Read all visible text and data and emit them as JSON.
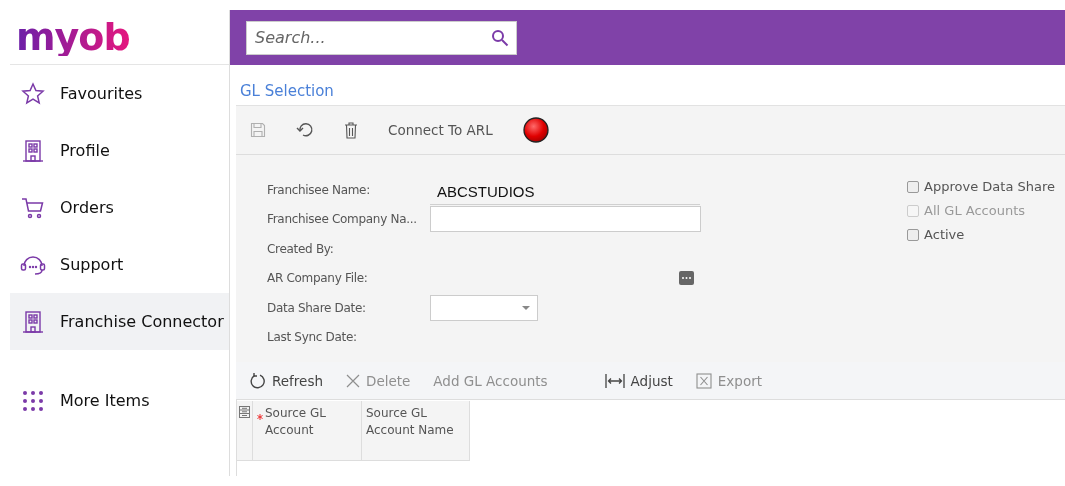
{
  "logo": "myob",
  "sidebar": {
    "items": [
      {
        "label": "Favourites",
        "kind": "star",
        "selected": false
      },
      {
        "label": "Profile",
        "kind": "building",
        "selected": false
      },
      {
        "label": "Orders",
        "kind": "cart",
        "selected": false
      },
      {
        "label": "Support",
        "kind": "headset",
        "selected": false
      },
      {
        "label": "Franchise Connector",
        "kind": "building",
        "selected": true
      },
      {
        "label": "More Items",
        "kind": "dots",
        "selected": false
      }
    ]
  },
  "search": {
    "placeholder": "Search..."
  },
  "page_title": "GL Selection",
  "toolbar": [
    {
      "kind": "save",
      "disabled": true
    },
    {
      "kind": "undo",
      "disabled": false
    },
    {
      "kind": "delete",
      "disabled": false
    },
    {
      "kind": "text",
      "label": "Connect To ARL",
      "disabled": false
    },
    {
      "kind": "status"
    }
  ],
  "form": {
    "fields": [
      {
        "label": "Franchisee Name:",
        "kind": "readonly",
        "value": "ABCSTUDIOS"
      },
      {
        "label": "Franchisee Company Na...",
        "kind": "input"
      },
      {
        "label": "Created By:",
        "kind": "empty"
      },
      {
        "label": "AR Company File:",
        "kind": "lookup"
      },
      {
        "label": "Data Share Date:",
        "kind": "select"
      },
      {
        "label": "Last Sync Date:",
        "kind": "empty"
      }
    ],
    "checkboxes": [
      {
        "label": "Approve Data Share",
        "checked": false,
        "disabled": false
      },
      {
        "label": "All GL Accounts",
        "checked": false,
        "disabled": true
      },
      {
        "label": "Active",
        "checked": false,
        "disabled": false
      }
    ]
  },
  "grid": {
    "toolbar": [
      {
        "kind": "refresh",
        "label": "Refresh",
        "disabled": false
      },
      {
        "kind": "delete",
        "label": "Delete",
        "disabled": true
      },
      {
        "kind": "text",
        "label": "Add GL Accounts",
        "disabled": true
      },
      {
        "kind": "adjust",
        "label": "Adjust",
        "disabled": false
      },
      {
        "kind": "export",
        "label": "Export",
        "disabled": true
      }
    ],
    "columns": [
      {
        "label": "Source GL Account",
        "required": true
      },
      {
        "label": "Source GL Account Name",
        "required": false
      }
    ]
  }
}
